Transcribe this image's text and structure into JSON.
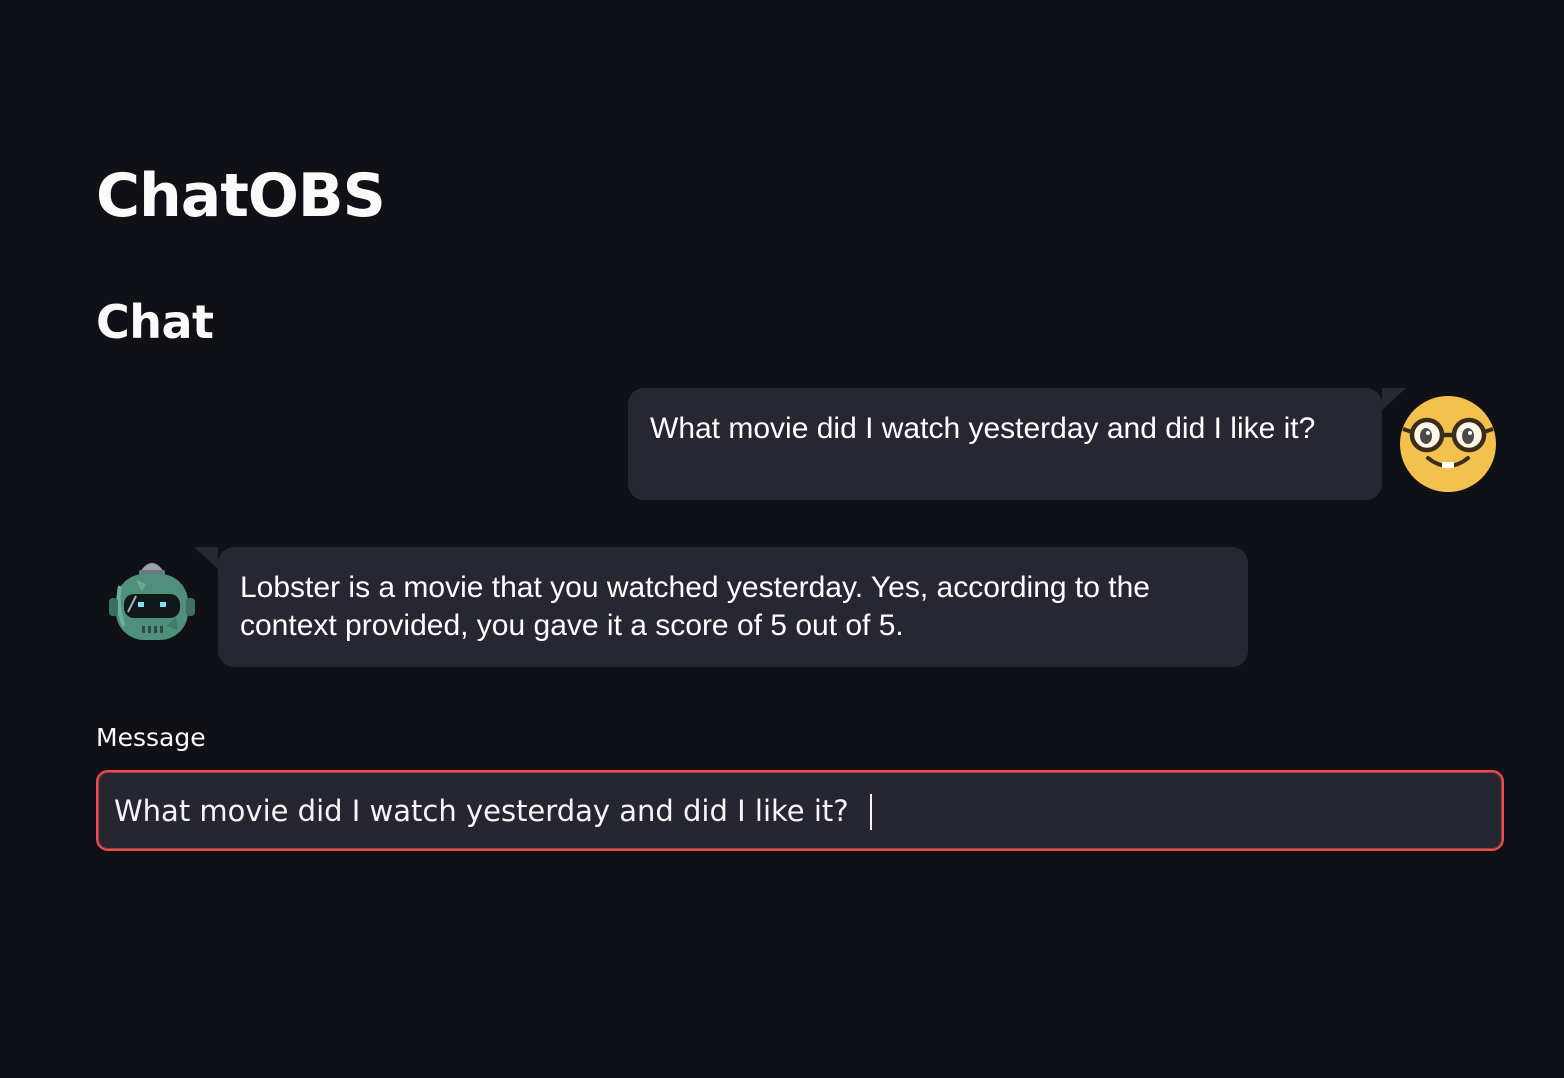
{
  "header": {
    "title": "ChatOBS",
    "section": "Chat"
  },
  "messages": [
    {
      "role": "user",
      "text": "What movie did I watch yesterday and did I like it?",
      "avatar_icon": "nerd-face-icon"
    },
    {
      "role": "assistant",
      "text": "Lobster is a movie that you watched yesterday. Yes, according to the context provided, you gave it a score of 5 out of 5.",
      "avatar_icon": "robot-icon"
    }
  ],
  "input": {
    "label": "Message",
    "value": "What movie did I watch yesterday and did I like it?"
  },
  "colors": {
    "background": "#101116",
    "bubble": "#262730",
    "input_border_focus": "#ff4b4b",
    "user_avatar": "#f2c14e",
    "bot_avatar": "#4f8f7b"
  }
}
